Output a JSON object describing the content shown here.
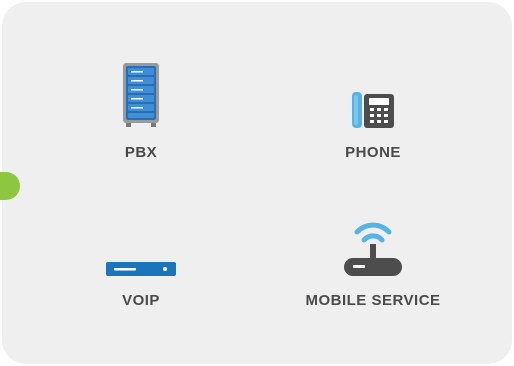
{
  "panel": {
    "accent_color": "#8dc63f",
    "background_color": "#efefef"
  },
  "services": [
    {
      "label": "PBX",
      "icon": "server-rack-icon"
    },
    {
      "label": "PHONE",
      "icon": "desk-phone-icon"
    },
    {
      "label": "VOIP",
      "icon": "voip-device-icon"
    },
    {
      "label": "MOBILE SERVICE",
      "icon": "wifi-router-icon"
    }
  ],
  "colors": {
    "icon_blue": "#1b75bc",
    "icon_light_blue": "#55b3e8",
    "icon_dark": "#4d4d4d",
    "label_text": "#4a4a4a"
  }
}
